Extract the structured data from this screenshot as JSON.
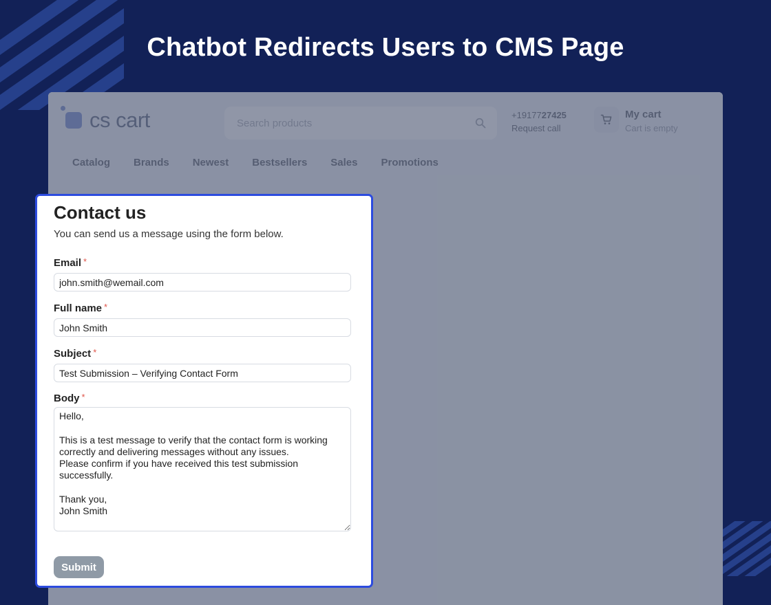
{
  "headline": "Chatbot Redirects Users to CMS Page",
  "store": {
    "logo_text": "cs cart",
    "search_placeholder": "Search products",
    "phone_prefix": "+19177",
    "phone_suffix": "27425",
    "request_call": "Request call",
    "cart_title": "My cart",
    "cart_status": "Cart is empty",
    "nav": [
      "Catalog",
      "Brands",
      "Newest",
      "Bestsellers",
      "Sales",
      "Promotions"
    ]
  },
  "form": {
    "title": "Contact us",
    "subtitle": "You can send us a message using the form below.",
    "required_mark": "*",
    "email_label": "Email",
    "email_value": "john.smith@wemail.com",
    "fullname_label": "Full name",
    "fullname_value": "John Smith",
    "subject_label": "Subject",
    "subject_value": "Test Submission – Verifying Contact Form",
    "body_label": "Body",
    "body_value": "Hello,\n\nThis is a test message to verify that the contact form is working correctly and delivering messages without any issues.\nPlease confirm if you have received this test submission successfully.\n\nThank you,\nJohn Smith",
    "submit_label": "Submit"
  },
  "colors": {
    "page_bg": "#122157",
    "modal_border": "#2c4bdf",
    "submit_bg": "#8f9aa6",
    "required": "#e0554a"
  }
}
